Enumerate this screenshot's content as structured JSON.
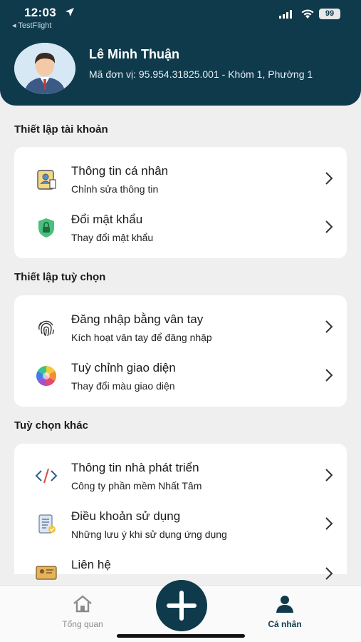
{
  "status_bar": {
    "time": "12:03",
    "back_app": "◂ TestFlight",
    "battery": "99"
  },
  "profile": {
    "name": "Lê Minh Thuận",
    "unit": "Mã đơn vị: 95.954.31825.001 - Khóm 1, Phường 1"
  },
  "sections": [
    {
      "title": "Thiết lập tài khoản",
      "items": [
        {
          "title": "Thông tin cá nhân",
          "subtitle": "Chỉnh sửa thông tin",
          "icon": "id-card-icon"
        },
        {
          "title": "Đổi mật khẩu",
          "subtitle": "Thay đổi mật khẩu",
          "icon": "shield-lock-icon"
        }
      ]
    },
    {
      "title": "Thiết lập tuỳ chọn",
      "items": [
        {
          "title": "Đăng nhập bằng vân tay",
          "subtitle": "Kích hoạt vân tay để đăng nhập",
          "icon": "fingerprint-icon"
        },
        {
          "title": "Tuỳ chỉnh giao diện",
          "subtitle": "Thay đổi màu giao diện",
          "icon": "color-wheel-icon"
        }
      ]
    },
    {
      "title": "Tuỳ chọn khác",
      "items": [
        {
          "title": "Thông tin nhà phát triển",
          "subtitle": "Công ty phần mềm Nhất Tâm",
          "icon": "code-icon"
        },
        {
          "title": "Điều khoản sử dụng",
          "subtitle": "Những lưu ý khi sử dụng ứng dụng",
          "icon": "document-icon"
        },
        {
          "title": "Liên hệ",
          "subtitle": "",
          "icon": "contact-card-icon"
        }
      ]
    }
  ],
  "bottom_nav": {
    "home_label": "Tổng quan",
    "profile_label": "Cá nhân"
  },
  "colors": {
    "primary": "#0e3a4b",
    "background": "#efefef",
    "card": "#ffffff"
  }
}
